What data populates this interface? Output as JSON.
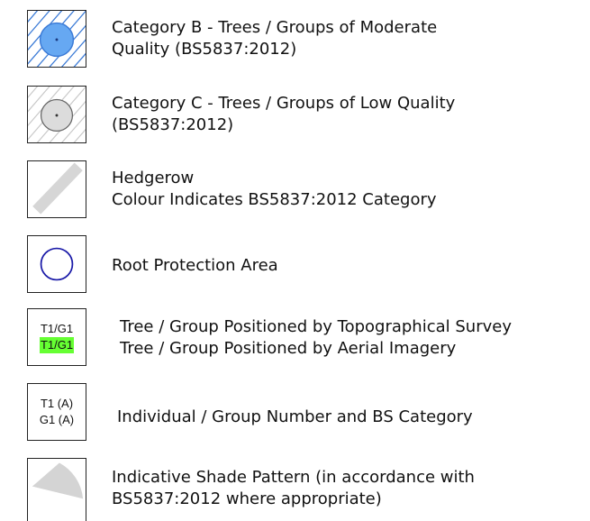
{
  "legend": {
    "items": [
      {
        "key": "category-b",
        "lines": [
          "Category B - Trees / Groups of Moderate",
          "Quality (BS5837:2012)"
        ]
      },
      {
        "key": "category-c",
        "lines": [
          "Category C - Trees / Groups of Low Quality",
          "(BS5837:2012)"
        ]
      },
      {
        "key": "hedgerow",
        "lines": [
          "Hedgerow",
          "Colour Indicates BS5837:2012 Category"
        ]
      },
      {
        "key": "rpa",
        "lines": [
          "Root Protection Area"
        ]
      },
      {
        "key": "positioning",
        "lines": [
          "Tree / Group Positioned by Topographical Survey",
          "Tree / Group Positioned by Aerial Imagery"
        ]
      },
      {
        "key": "numbering",
        "lines": [
          "Individual / Group Number and BS Category"
        ]
      },
      {
        "key": "shade",
        "lines": [
          "Indicative Shade Pattern (in accordance with",
          "BS5837:2012 where appropriate)"
        ]
      }
    ],
    "tags": {
      "survey": "T1/G1",
      "aerial": "T1/G1",
      "individual": "T1 (A)",
      "group": "G1 (A)"
    }
  },
  "colors": {
    "category_b_fill": "#66a8f2",
    "category_b_hatch": "#3a7ad6",
    "category_c_fill": "#dcdcdc",
    "category_c_hatch": "#c8c8c8",
    "hedgerow": "#d6d6d6",
    "rpa_ring": "#1a1aa8",
    "aerial_highlight": "#66ff33",
    "shade": "#d4d4d4"
  }
}
